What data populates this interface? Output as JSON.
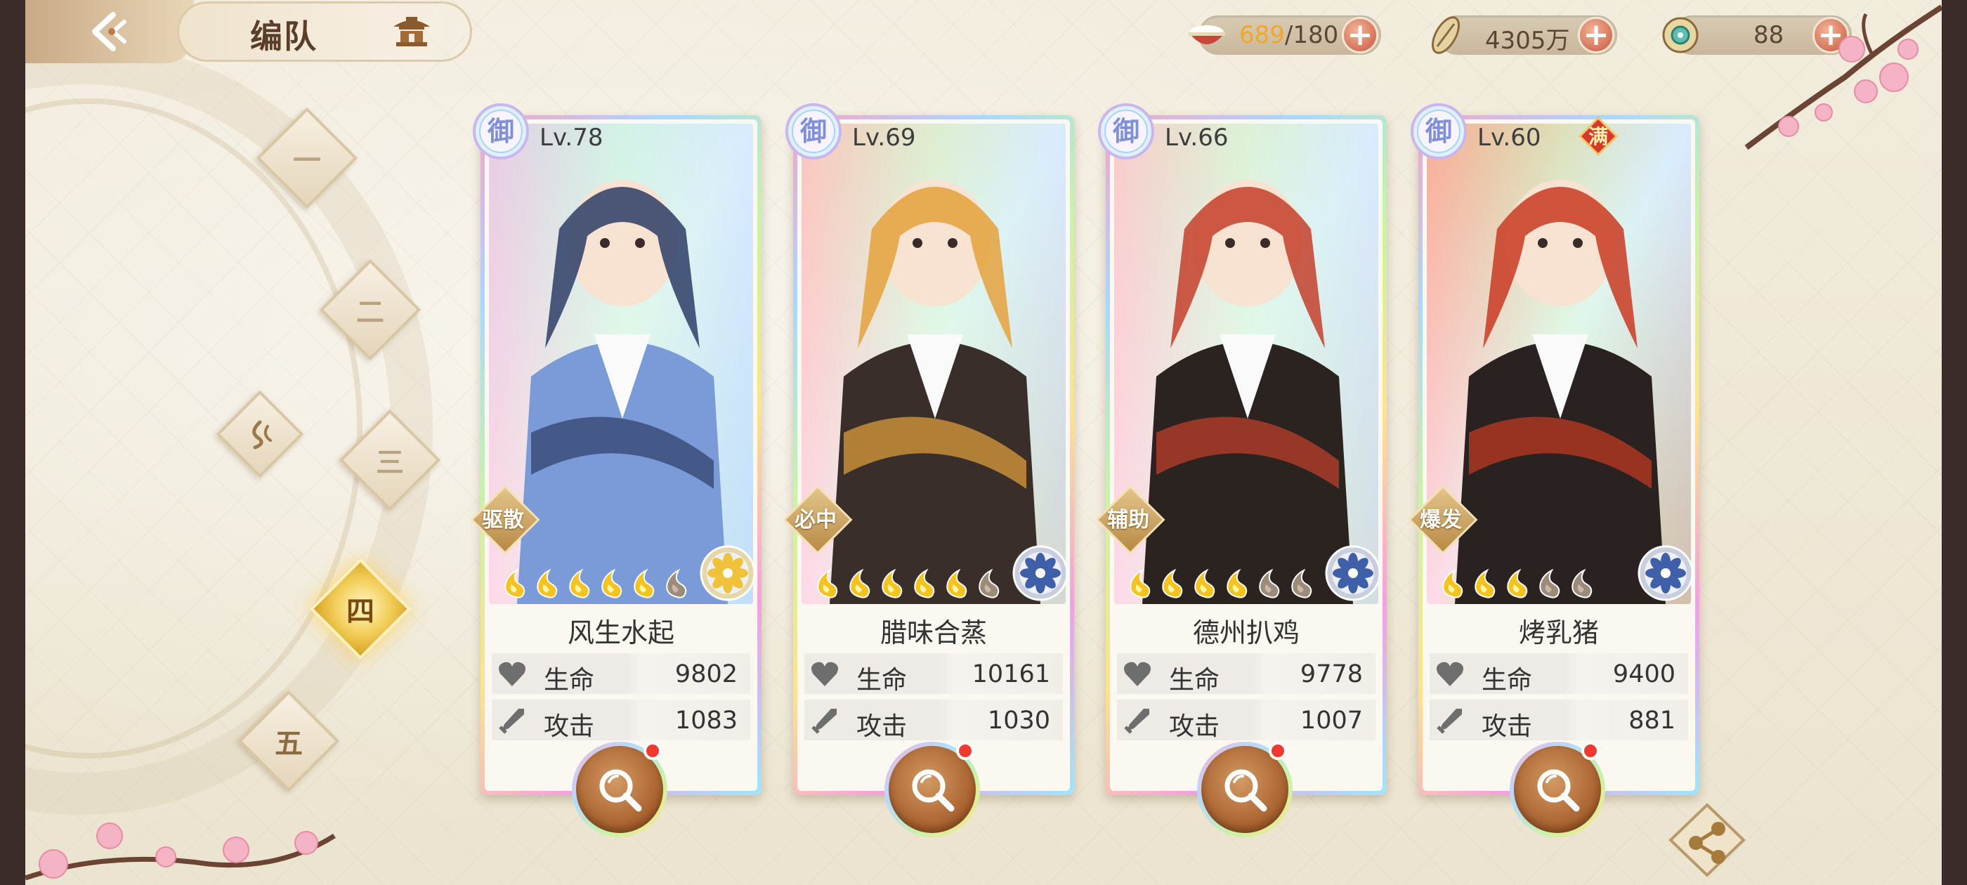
{
  "header": {
    "title": "编队",
    "back_icon": "back-arrow-icon",
    "home_icon": "pavilion-icon"
  },
  "resources": [
    {
      "name": "stamina",
      "icon": "food-bowl-icon",
      "current": "689",
      "max": "/180",
      "current_color": "#f0a82a"
    },
    {
      "name": "coins",
      "icon": "scroll-coin-icon",
      "value": "4305万"
    },
    {
      "name": "jade",
      "icon": "jade-icon",
      "value": "88"
    }
  ],
  "teams": [
    {
      "label": "一",
      "active": false
    },
    {
      "label": "二",
      "active": false
    },
    {
      "label": "三",
      "active": false
    },
    {
      "label": "四",
      "active": true
    },
    {
      "label": "五",
      "active": false
    }
  ],
  "cards": [
    {
      "badge": "御",
      "level": "Lv.78",
      "role": "驱散",
      "name": "风生水起",
      "stars_filled": 5,
      "stars_total": 6,
      "element": "gold-flower",
      "hp_label": "生命",
      "hp": "9802",
      "atk_label": "攻击",
      "atk": "1083",
      "full": false,
      "palette": [
        "#cfe6f5",
        "#7a9ad8",
        "#2d3d66"
      ]
    },
    {
      "badge": "御",
      "level": "Lv.69",
      "role": "必中",
      "name": "腊味合蒸",
      "stars_filled": 5,
      "stars_total": 6,
      "element": "blue-flower",
      "hp_label": "生命",
      "hp": "10161",
      "atk_label": "攻击",
      "atk": "1030",
      "full": false,
      "palette": [
        "#f6d7a8",
        "#3a2e2a",
        "#e4a23c"
      ]
    },
    {
      "badge": "御",
      "level": "Lv.66",
      "role": "辅助",
      "name": "德州扒鸡",
      "stars_filled": 4,
      "stars_total": 6,
      "element": "blue-flower",
      "hp_label": "生命",
      "hp": "9778",
      "atk_label": "攻击",
      "atk": "1007",
      "full": false,
      "palette": [
        "#f3e4c2",
        "#2b2320",
        "#c4402c"
      ]
    },
    {
      "badge": "御",
      "level": "Lv.60",
      "role": "爆发",
      "name": "烤乳猪",
      "stars_filled": 3,
      "stars_total": 5,
      "element": "blue-flower",
      "hp_label": "生命",
      "hp": "9400",
      "atk_label": "攻击",
      "atk": "881",
      "full": true,
      "full_label": "满",
      "palette": [
        "#f2a75a",
        "#2a2220",
        "#c93a22"
      ]
    }
  ]
}
